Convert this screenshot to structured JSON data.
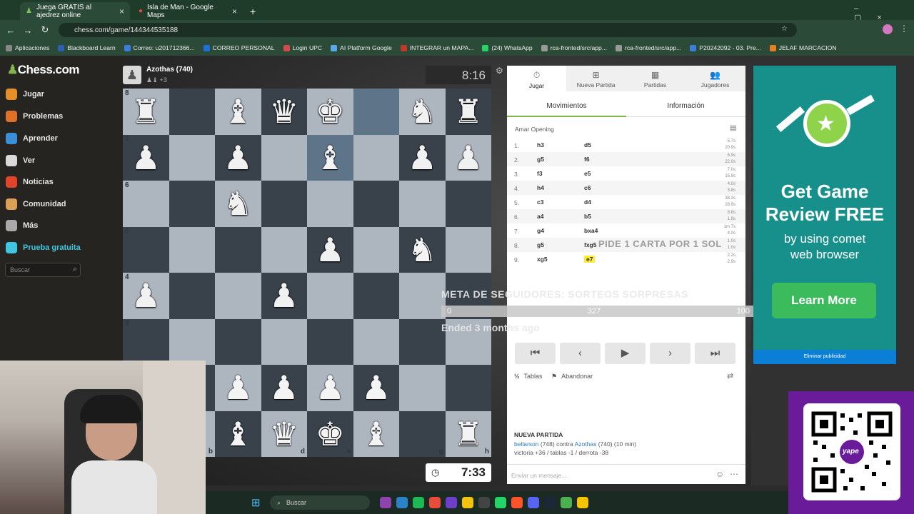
{
  "browser": {
    "tabs": [
      {
        "label": "Juega GRATIS al ajedrez online",
        "active": true
      },
      {
        "label": "Isla de Man - Google Maps",
        "active": false
      }
    ],
    "url": "chess.com/game/144344535188",
    "bookmarks": [
      "Aplicaciones",
      "Blackboard Learn",
      "Correo: u201712366...",
      "CORREO PERSONAL",
      "Login UPC",
      "AI Platform Google",
      "INTEGRAR un MAPA...",
      "(24) WhatsApp",
      "rca-fronted/src/app...",
      "rca-fronted/src/app...",
      "P20242092 - 03. Pre...",
      "JELAF MARCACION"
    ]
  },
  "sidebar": {
    "logo": "Chess.com",
    "items": [
      {
        "label": "Jugar",
        "color": "#e58f2a"
      },
      {
        "label": "Problemas",
        "color": "#e0712b"
      },
      {
        "label": "Aprender",
        "color": "#3a8fd6"
      },
      {
        "label": "Ver",
        "color": "#d9d9d9"
      },
      {
        "label": "Noticias",
        "color": "#e0452b"
      },
      {
        "label": "Comunidad",
        "color": "#d9a057"
      },
      {
        "label": "Más",
        "color": "#aaaaaa"
      },
      {
        "label": "Prueba gratuita",
        "color": "#3fc7e0"
      }
    ],
    "search_placeholder": "Buscar"
  },
  "game": {
    "top_player": "Azothas (740)",
    "top_captured": "+3",
    "clock_top": "8:16",
    "clock_bottom": "7:33",
    "ranks": [
      "8",
      "7",
      "6",
      "5",
      "4",
      "3"
    ],
    "files": [
      "b",
      "d",
      "e",
      "g",
      "h"
    ]
  },
  "panel": {
    "tabs": [
      "Jugar",
      "Nueva Partida",
      "Partidas",
      "Jugadores"
    ],
    "subtabs": [
      "Movimientos",
      "Información"
    ],
    "opening": "Amar Opening",
    "moves": [
      {
        "n": "1.",
        "w": "h3",
        "b": "d5",
        "t1": "5.7s",
        "t2": "20.9s"
      },
      {
        "n": "2.",
        "w": "g5",
        "b": "f6",
        "t1": "6.9s",
        "t2": "22.0s"
      },
      {
        "n": "3.",
        "w": "f3",
        "b": "e5",
        "t1": "7.0s",
        "t2": "15.9s"
      },
      {
        "n": "4.",
        "w": "h4",
        "b": "c6",
        "t1": "4.0s",
        "t2": "3.8s"
      },
      {
        "n": "5.",
        "w": "c3",
        "b": "d4",
        "t1": "38.3s",
        "t2": "28.9s"
      },
      {
        "n": "6.",
        "w": "a4",
        "b": "b5",
        "t1": "8.8s",
        "t2": "1.9s"
      },
      {
        "n": "7.",
        "w": "g4",
        "b": "bxa4",
        "t1": "1m 7s",
        "t2": "4.0s"
      },
      {
        "n": "8.",
        "w": "g5",
        "b": "fxg5",
        "t1": "1.0s",
        "t2": "1.0s"
      },
      {
        "n": "9.",
        "w": "xg5",
        "b": "e7",
        "t1": "2.2s",
        "t2": "2.9s"
      }
    ],
    "draw_label": "Tablas",
    "resign_label": "Abandonar",
    "new_game_title": "NUEVA PARTIDA",
    "new_game_p1": "bellarson",
    "new_game_p1_rating": "(748) contra",
    "new_game_p2": "Azothas",
    "new_game_p2_rating": "(740) (10 min)",
    "new_game_stats": "victoria +36 / tablas -1 / derrota -38",
    "message_placeholder": "Enviar un mensaje..."
  },
  "overlays": {
    "goal": "META DE SEGUIDORES: SORTEOS SORPRESAS",
    "progress_min": "0",
    "progress_value": "327",
    "progress_max": "100",
    "ended": "Ended 3 months ago",
    "pide": "PIDE 1 CARTA POR 1 SOL"
  },
  "ad": {
    "title_line1": "Get Game",
    "title_line2": "Review FREE",
    "sub_line1": "by using comet",
    "sub_line2": "web browser",
    "button": "Learn More",
    "footer": "Eliminar publicidad"
  },
  "qr": {
    "label": "yape"
  },
  "taskbar": {
    "search": "Buscar"
  }
}
